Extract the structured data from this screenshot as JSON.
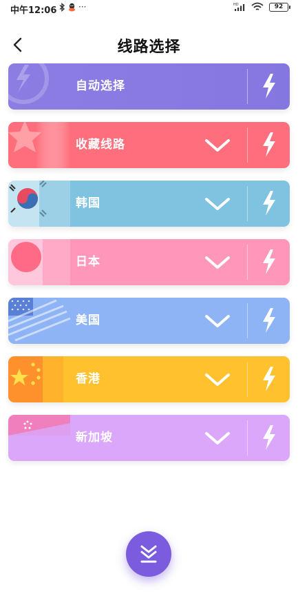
{
  "status_bar": {
    "time": "中午12:06",
    "more": "···",
    "battery": "92"
  },
  "header": {
    "title": "线路选择"
  },
  "routes": [
    {
      "label": "自动选择",
      "color": "#8a7be0",
      "deco": "lightning-logo",
      "has_chevron": false
    },
    {
      "label": "收藏线路",
      "color": "#ff6e7c",
      "deco": "star",
      "has_chevron": true
    },
    {
      "label": "韩国",
      "color": "#7fc3e0",
      "deco": "korea-flag",
      "has_chevron": true
    },
    {
      "label": "日本",
      "color": "#ff97bb",
      "deco": "japan-flag",
      "has_chevron": true
    },
    {
      "label": "美国",
      "color": "#8fb4f5",
      "deco": "usa-flag",
      "has_chevron": true
    },
    {
      "label": "香港",
      "color": "#ffc22e",
      "deco": "china-flag",
      "has_chevron": true
    },
    {
      "label": "新加坡",
      "color": "#dba7fb",
      "deco": "singapore-flag",
      "has_chevron": true
    }
  ],
  "fab": {
    "icon": "collapse-down-icon",
    "color": "#7b5cde"
  }
}
